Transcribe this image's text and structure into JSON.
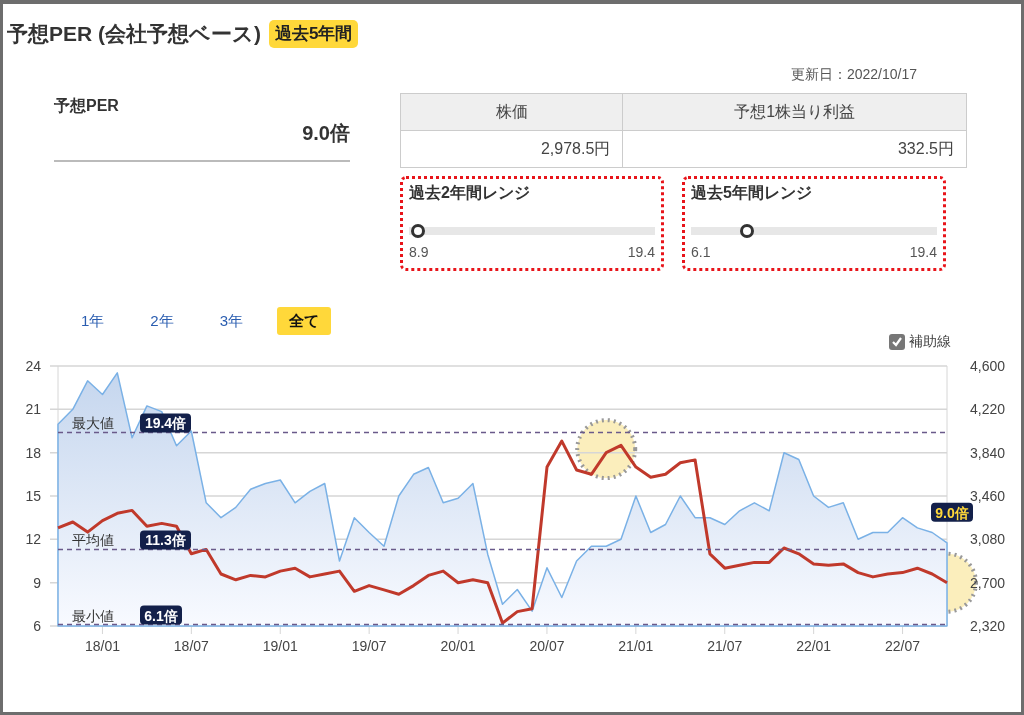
{
  "header": {
    "title": "予想PER (会社予想ベース)",
    "badge": "過去5年間"
  },
  "updated": "更新日：2022/10/17",
  "per": {
    "label": "予想PER",
    "value": "9.0倍"
  },
  "price_table": {
    "columns": [
      "株価",
      "予想1株当り利益"
    ],
    "values": [
      "2,978.5円",
      "332.5円"
    ]
  },
  "ranges": [
    {
      "title": "過去2年間レンジ",
      "min": "8.9",
      "max": "19.4",
      "level": 0.01
    },
    {
      "title": "過去5年間レンジ",
      "min": "6.1",
      "max": "19.4",
      "level": 0.21
    }
  ],
  "period_tabs": [
    {
      "label": "1年",
      "selected": false
    },
    {
      "label": "2年",
      "selected": false
    },
    {
      "label": "3年",
      "selected": false
    },
    {
      "label": "全て",
      "selected": true
    }
  ],
  "guide_lines": {
    "label": "補助線",
    "checked": true
  },
  "chart": {
    "chart_data": {
      "type": "line",
      "grid": true,
      "ylim": [
        6,
        24
      ],
      "y2lim": [
        2320,
        4600
      ],
      "categories": [
        null,
        null,
        null,
        "18/01",
        null,
        null,
        null,
        null,
        null,
        "18/07",
        null,
        null,
        null,
        null,
        null,
        "19/01",
        null,
        null,
        null,
        null,
        null,
        "19/07",
        null,
        null,
        null,
        null,
        null,
        "20/01",
        null,
        null,
        null,
        null,
        null,
        "20/07",
        null,
        null,
        null,
        null,
        null,
        "21/01",
        null,
        null,
        null,
        null,
        null,
        "21/07",
        null,
        null,
        null,
        null,
        null,
        "22/01",
        null,
        null,
        null,
        null,
        null,
        "22/07",
        null,
        null,
        null
      ],
      "yticks": [
        6,
        9,
        12,
        15,
        18,
        21,
        24
      ],
      "y2ticks": [
        {
          "value": 2320,
          "label": "2,320"
        },
        {
          "value": 2700,
          "label": "2,700"
        },
        {
          "value": 3080,
          "label": "3,080"
        },
        {
          "value": 3460,
          "label": "3,460"
        },
        {
          "value": 3840,
          "label": "3,840"
        },
        {
          "value": 4220,
          "label": "4,220"
        },
        {
          "value": 4600,
          "label": "4,600"
        }
      ],
      "series": [
        {
          "type": "area",
          "color": "#7ab1e6",
          "axis": "y2",
          "values": [
            4090,
            4220,
            4470,
            4350,
            4540,
            3970,
            4250,
            4200,
            3900,
            4030,
            3400,
            3270,
            3360,
            3520,
            3570,
            3600,
            3400,
            3500,
            3570,
            2890,
            3270,
            3140,
            3020,
            3460,
            3650,
            3710,
            3400,
            3440,
            3570,
            2950,
            2510,
            2640,
            2450,
            2830,
            2570,
            2890,
            3020,
            3020,
            3080,
            3460,
            3140,
            3210,
            3460,
            3270,
            3270,
            3210,
            3330,
            3400,
            3330,
            3840,
            3780,
            3460,
            3360,
            3400,
            3080,
            3140,
            3140,
            3270,
            3180,
            3140,
            3050
          ]
        },
        {
          "color": "#c0392b",
          "values": [
            12.8,
            13.2,
            12.5,
            13.3,
            13.8,
            14.0,
            12.9,
            13.1,
            12.9,
            11.0,
            11.3,
            9.6,
            9.2,
            9.5,
            9.4,
            9.8,
            10.0,
            9.4,
            9.6,
            9.8,
            8.4,
            8.8,
            8.5,
            8.2,
            8.8,
            9.5,
            9.8,
            9.0,
            9.2,
            9.0,
            6.2,
            7.0,
            7.2,
            17.0,
            18.8,
            16.8,
            16.5,
            18.0,
            18.5,
            17.0,
            16.3,
            16.5,
            17.3,
            17.5,
            11.0,
            10.0,
            10.2,
            10.4,
            10.4,
            11.4,
            11.0,
            10.3,
            10.2,
            10.3,
            9.7,
            9.4,
            9.6,
            9.7,
            10.0,
            9.6,
            9.0
          ]
        }
      ],
      "ref_lines": [
        {
          "axis": "y",
          "value": 19.4,
          "label": "最大値"
        },
        {
          "axis": "y",
          "value": 11.3,
          "label": "平均値"
        },
        {
          "axis": "y",
          "value": 6.1,
          "label": "最小値"
        }
      ],
      "annotations": [
        "19.4倍",
        "11.3倍",
        "6.1倍",
        "9.0倍"
      ]
    }
  }
}
